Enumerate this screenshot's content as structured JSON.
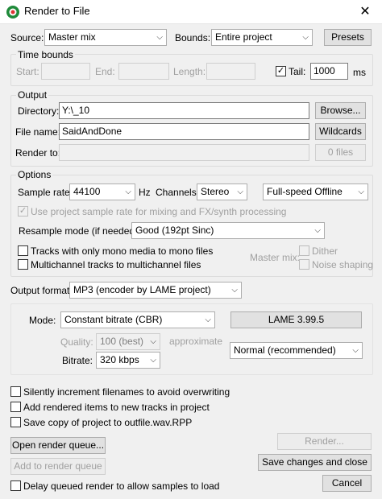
{
  "window": {
    "title": "Render to File",
    "close_glyph": "✕",
    "accent": "#1f8a3a"
  },
  "source": {
    "label": "Source:",
    "value": "Master mix"
  },
  "bounds": {
    "label": "Bounds:",
    "value": "Entire project"
  },
  "presets_button": "Presets",
  "time_bounds": {
    "title": "Time bounds",
    "start_label": "Start:",
    "end_label": "End:",
    "length_label": "Length:",
    "tail_label": "Tail:",
    "tail_checked": true,
    "tail_value": "1000",
    "tail_unit": "ms"
  },
  "output": {
    "title": "Output",
    "directory_label": "Directory:",
    "directory_value": "Y:\\_10",
    "browse_button": "Browse...",
    "filename_label": "File name:",
    "filename_value": "SaidAndDone",
    "wildcards_button": "Wildcards",
    "render_to_label": "Render to:",
    "render_to_value": "",
    "files_button": "0 files"
  },
  "options": {
    "title": "Options",
    "sample_rate_label": "Sample rate:",
    "sample_rate_value": "44100",
    "sample_rate_unit": "Hz",
    "channels_label": "Channels:",
    "channels_value": "Stereo",
    "speed_value": "Full-speed Offline",
    "use_project_rate_label": "Use project sample rate for mixing and FX/synth processing",
    "use_project_rate_checked": true,
    "resample_label": "Resample mode (if needed):",
    "resample_value": "Good (192pt Sinc)",
    "mono_label": "Tracks with only mono media to mono files",
    "mono_checked": false,
    "multichannel_label": "Multichannel tracks to multichannel files",
    "multichannel_checked": false,
    "master_mix_label": "Master mix:",
    "dither_label": "Dither",
    "noise_shaping_label": "Noise shaping"
  },
  "output_format": {
    "label": "Output format:",
    "value": "MP3 (encoder by LAME project)"
  },
  "mp3": {
    "mode_label": "Mode:",
    "mode_value": "Constant bitrate  (CBR)",
    "lame_button": "LAME 3.99.5",
    "quality_label": "Quality:",
    "quality_value": "100 (best)",
    "approximate_label": "approximate",
    "encoding_value": "Normal (recommended)",
    "bitrate_label": "Bitrate:",
    "bitrate_value": "320 kbps"
  },
  "checks": {
    "silently_increment": "Silently increment filenames to avoid overwriting",
    "add_rendered": "Add rendered items to new tracks in project",
    "save_copy": "Save copy of project to outfile.wav.RPP",
    "delay_queued": "Delay queued render to allow samples to load"
  },
  "buttons": {
    "open_queue": "Open render queue...",
    "add_queue": "Add to render queue",
    "render": "Render...",
    "save_close": "Save changes and close",
    "cancel": "Cancel"
  }
}
